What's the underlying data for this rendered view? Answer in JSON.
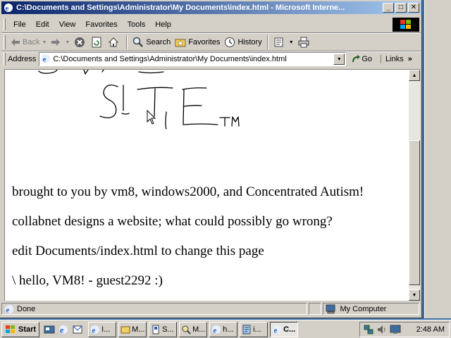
{
  "window": {
    "title": "C:\\Documents and Settings\\Administrator\\My Documents\\index.html - Microsoft Interne...",
    "caption_minimize": "_",
    "caption_maximize": "□",
    "caption_close": "✕"
  },
  "menu": {
    "items": [
      "File",
      "Edit",
      "View",
      "Favorites",
      "Tools",
      "Help"
    ]
  },
  "toolbar": {
    "back": "Back",
    "search": "Search",
    "favorites": "Favorites",
    "history": "History"
  },
  "address": {
    "label": "Address",
    "value": "C:\\Documents and Settings\\Administrator\\My Documents\\index.html",
    "go": "Go",
    "links": "Links",
    "chevron": "»"
  },
  "page": {
    "logo_text": "SITE",
    "trademark": "TM",
    "lines": [
      "brought to you by vm8, windows2000, and Concentrated Autism!",
      "collabnet designs a website; what could possibly go wrong?",
      "edit Documents/index.html to change this page",
      "\\ hello, VM8! - guest2292 :)"
    ]
  },
  "status": {
    "text": "Done",
    "zone": "My Computer"
  },
  "taskbar": {
    "start": "Start",
    "tasks": [
      "I...",
      "M...",
      "S...",
      "M...",
      "h...",
      "i...",
      "C..."
    ],
    "clock": "2:48 AM"
  },
  "colors": {
    "title_active": "#0a246a",
    "title_fade": "#a6caf0",
    "chrome": "#d4d0c8",
    "desktop": "#3a6ea5"
  }
}
